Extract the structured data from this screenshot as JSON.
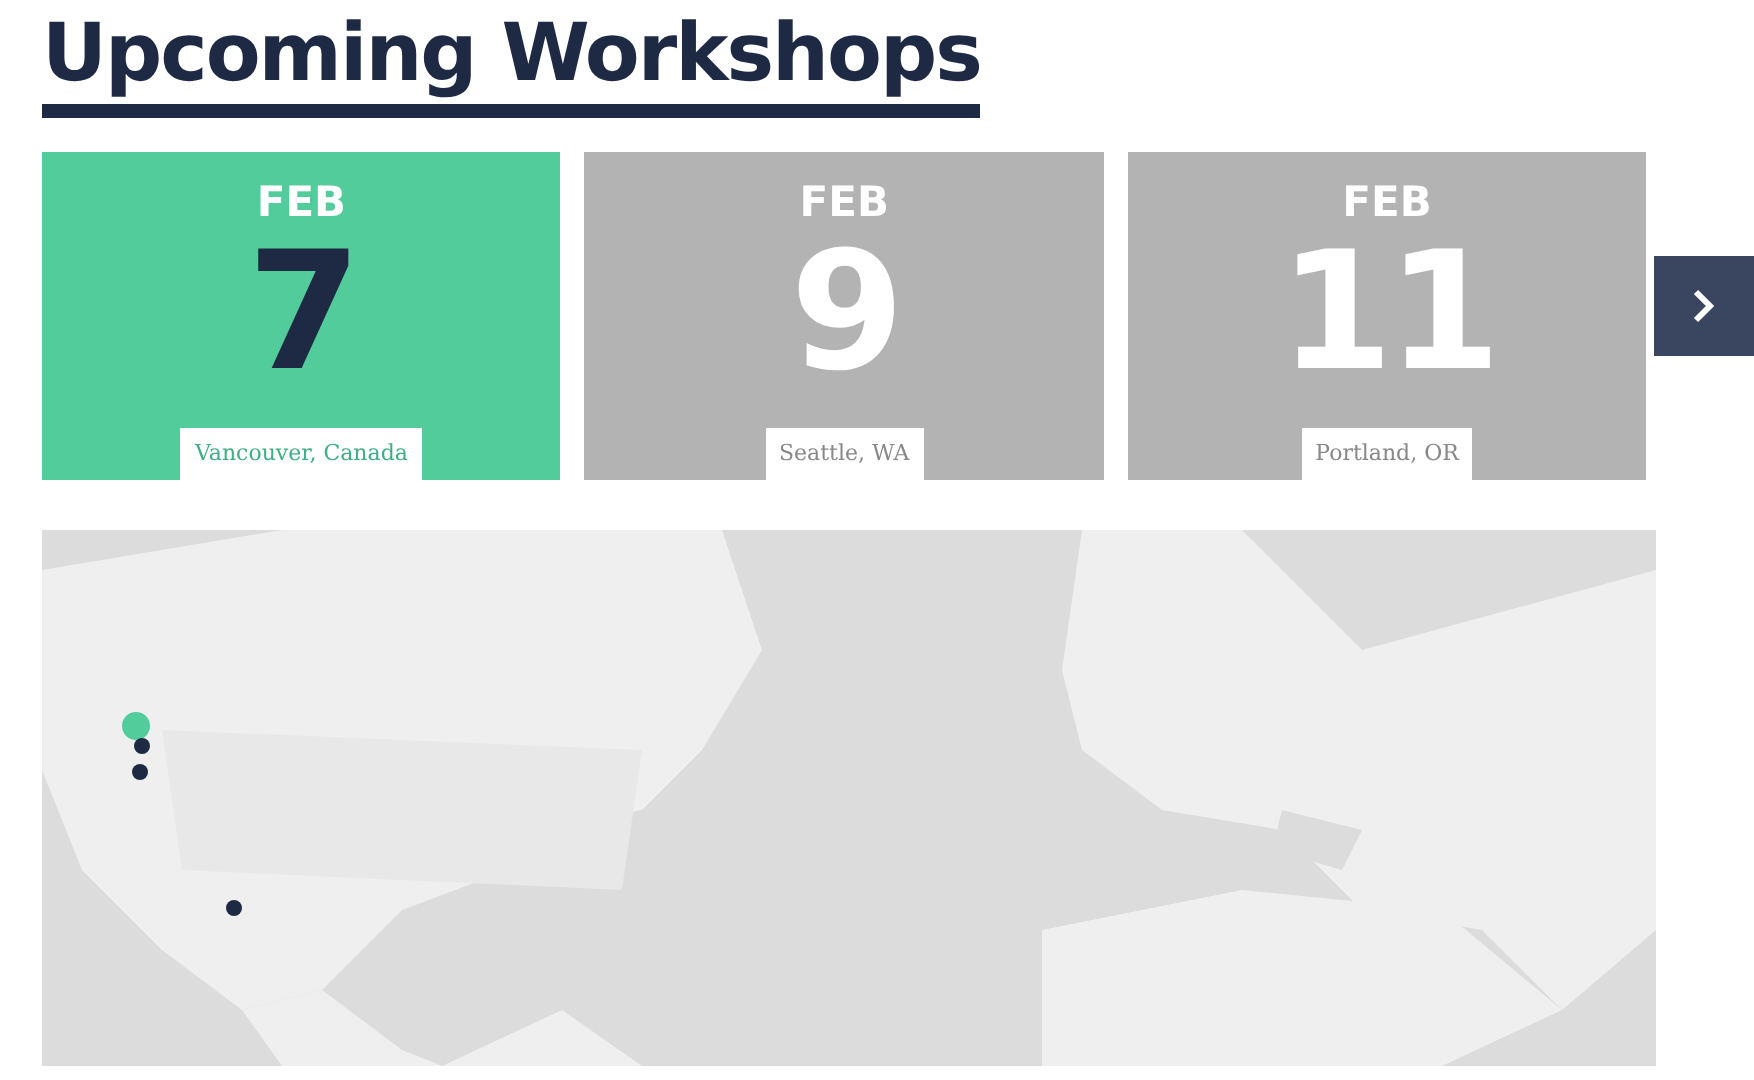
{
  "title": "Upcoming Workshops",
  "workshops": [
    {
      "month": "FEB",
      "day": "7",
      "location": "Vancouver, Canada",
      "selected": true
    },
    {
      "month": "FEB",
      "day": "9",
      "location": "Seattle, WA",
      "selected": false
    },
    {
      "month": "FEB",
      "day": "11",
      "location": "Portland, OR",
      "selected": false
    }
  ]
}
